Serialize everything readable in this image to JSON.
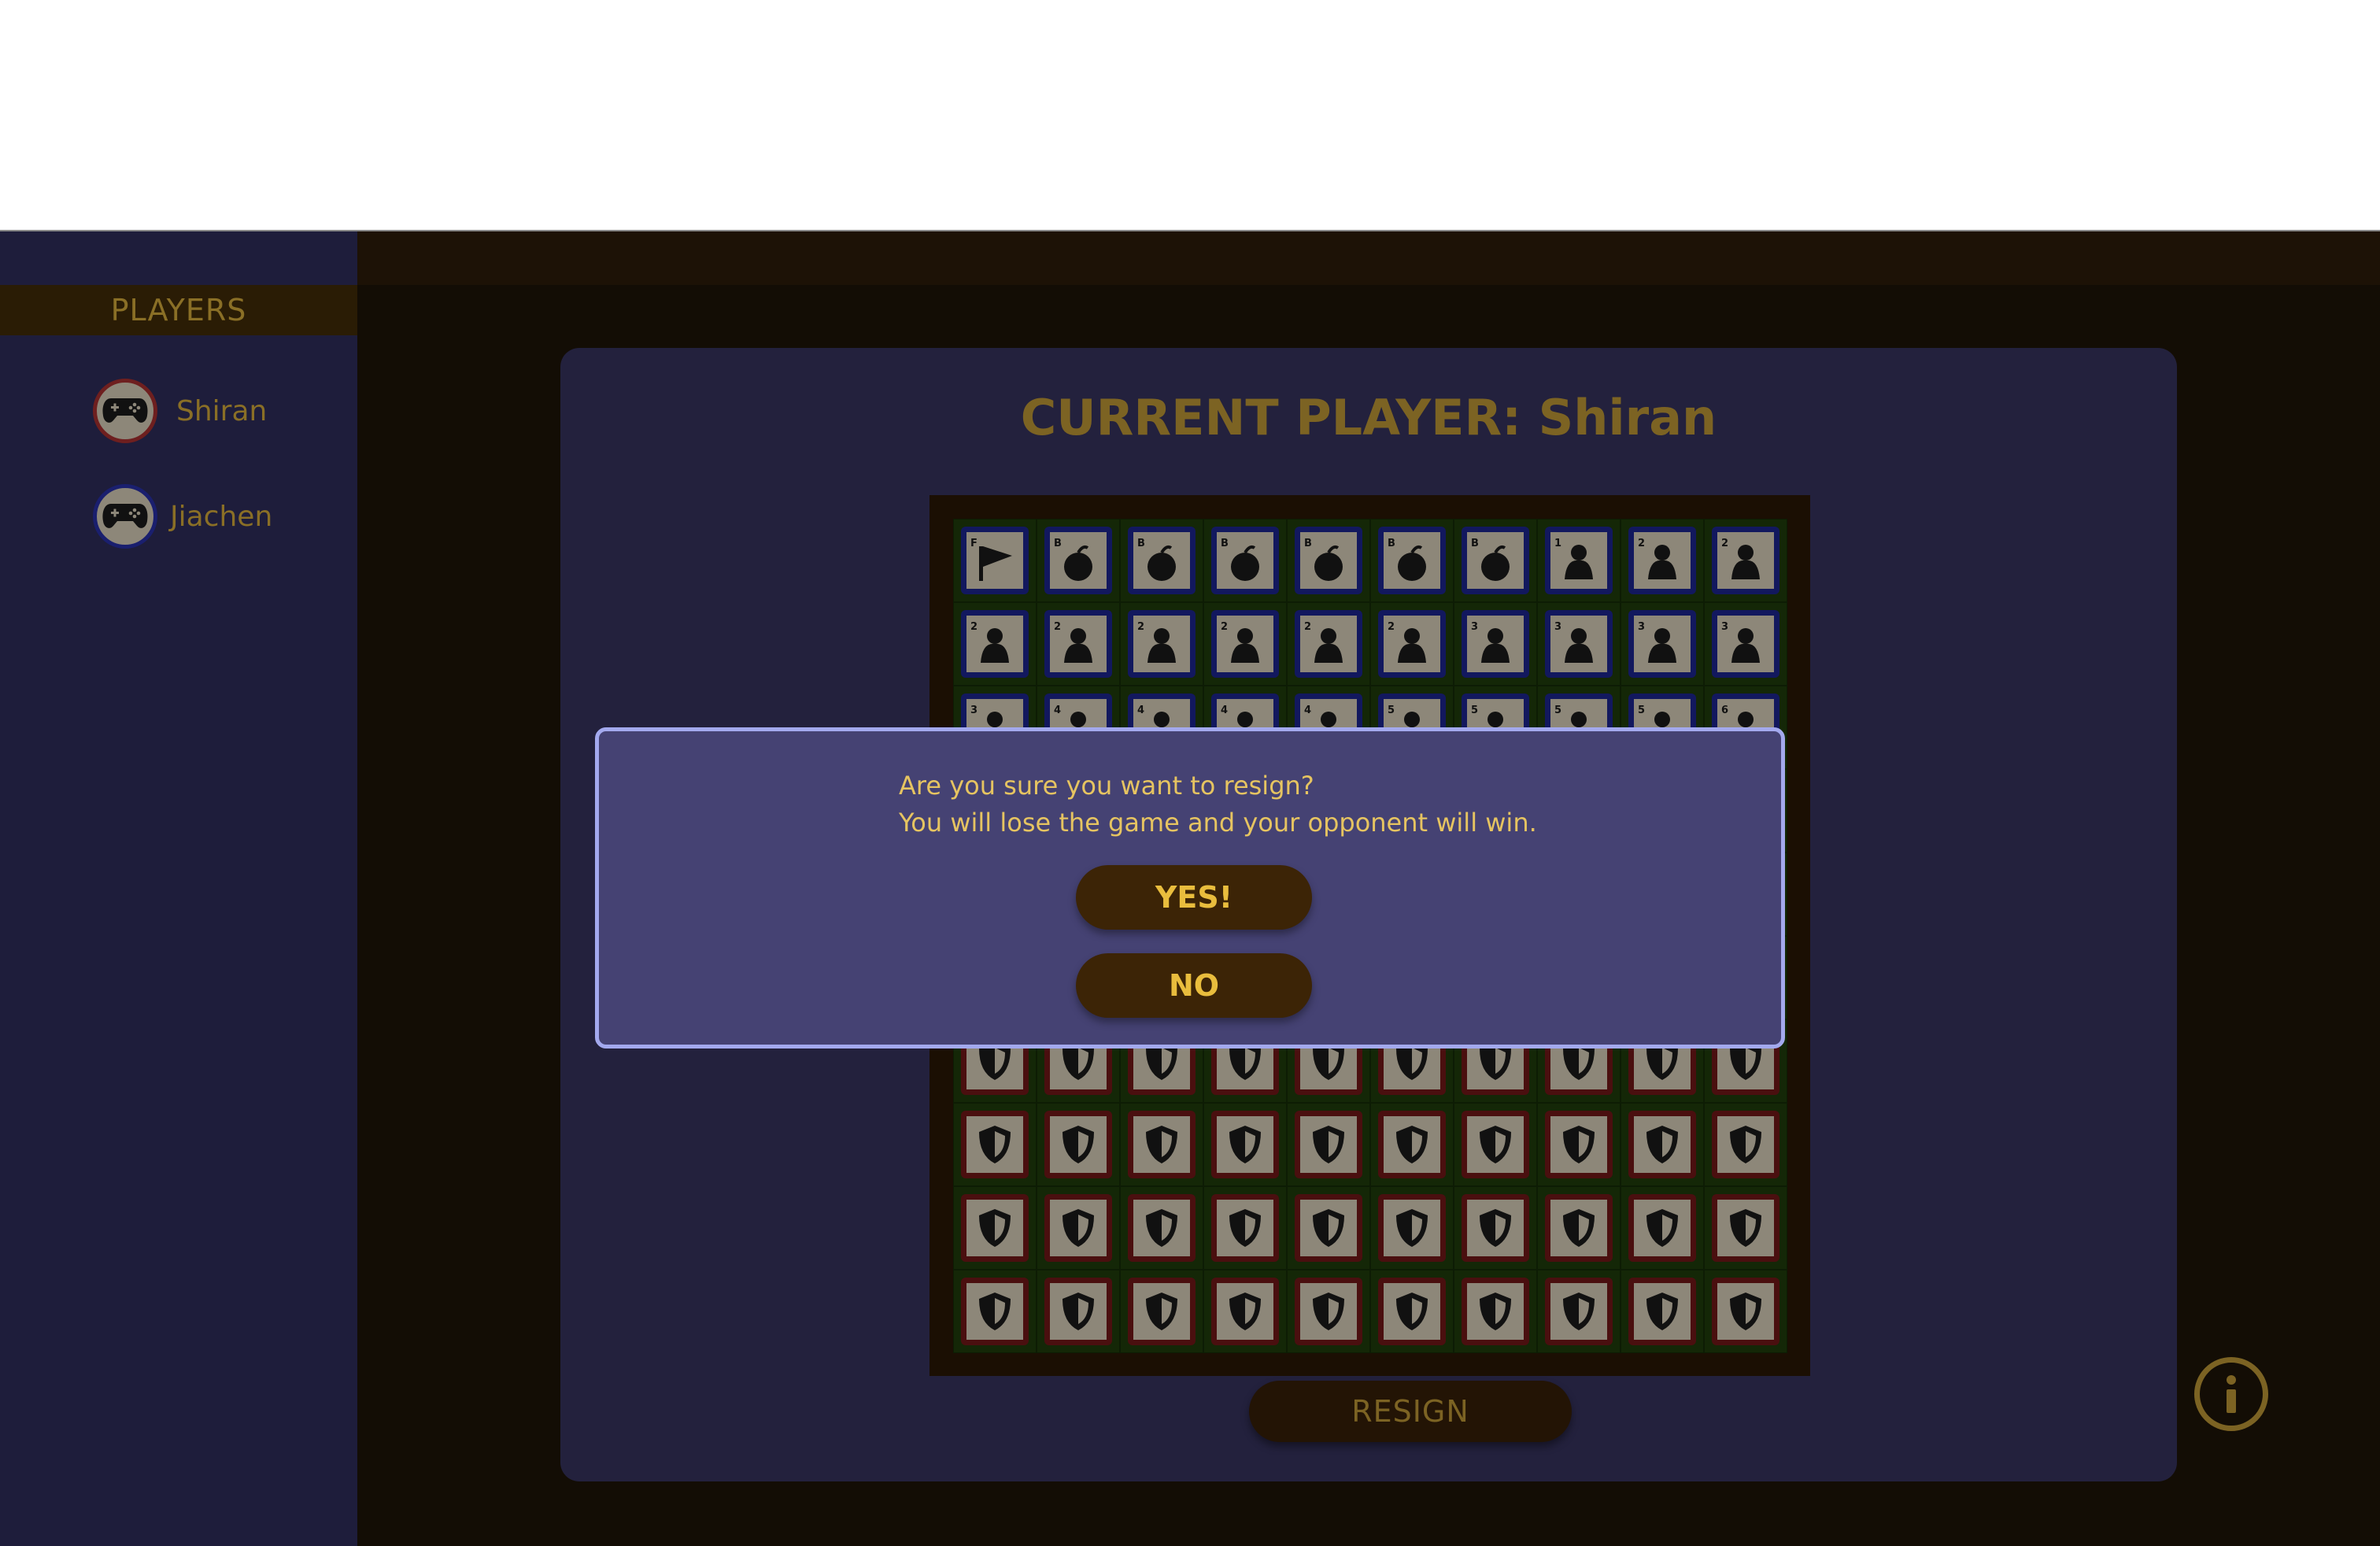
{
  "sidebar": {
    "header": "PLAYERS",
    "players": [
      {
        "name": "Shiran",
        "ring_color": "#6e1f1f"
      },
      {
        "name": "Jiachen",
        "ring_color": "#1a1f6e"
      }
    ]
  },
  "game": {
    "current_player_label": "CURRENT PLAYER: Shiran",
    "resign_label": "RESIGN",
    "board": {
      "rows": 10,
      "cols": 10,
      "top_rows": [
        [
          "F",
          "B",
          "B",
          "B",
          "B",
          "B",
          "B",
          "1",
          "2",
          "2"
        ],
        [
          "2",
          "2",
          "2",
          "2",
          "2",
          "2",
          "3",
          "3",
          "3",
          "3"
        ],
        [
          "3",
          "4",
          "4",
          "4",
          "4",
          "5",
          "5",
          "5",
          "5",
          "6"
        ]
      ],
      "opponent_piece": "shield-icon",
      "own_color": "#12185e",
      "opponent_color": "#4a0f0f"
    }
  },
  "info_button": {
    "icon": "info-icon"
  },
  "dialog": {
    "line1": "Are you sure you want to resign?",
    "line2": "You will lose the game and your opponent will win.",
    "yes_label": "YES!",
    "no_label": "NO"
  },
  "colors": {
    "accent_gold": "#e9bd3d",
    "dim_gold": "#7c6323",
    "panel": "#23213d",
    "modal": "#454273"
  }
}
